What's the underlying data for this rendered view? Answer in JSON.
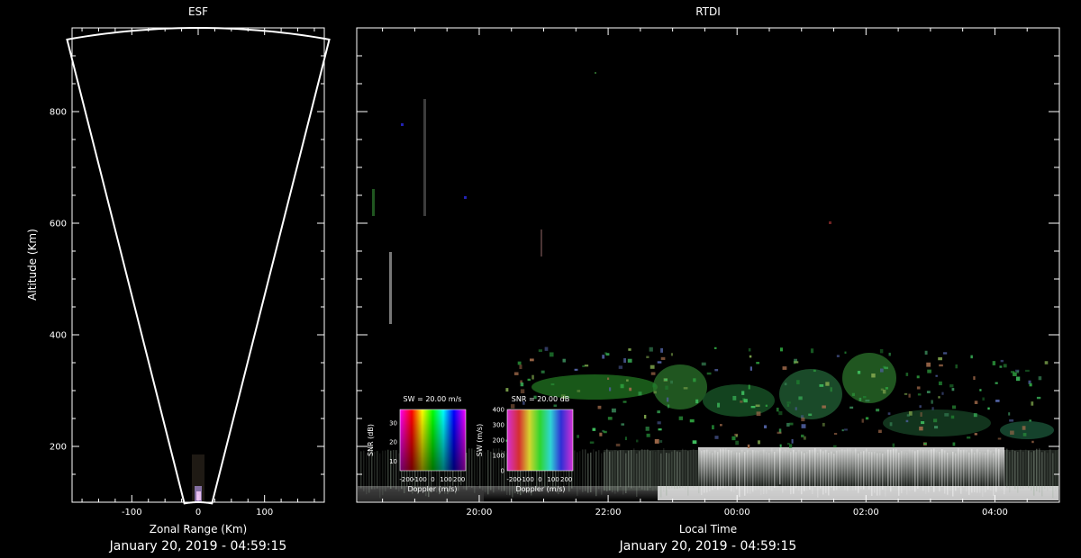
{
  "esf": {
    "title": "ESF",
    "xlabel": "Zonal Range (Km)",
    "ylabel": "Altitude (Km)",
    "date": "January 20, 2019 - 04:59:15"
  },
  "rtdi": {
    "title": "RTDI",
    "xlabel": "Local Time",
    "date": "January 20, 2019 - 04:59:15"
  },
  "legend_sw": {
    "title": "SW = 20.00 m/s",
    "ylabel": "SNR (dB)",
    "xlabel": "Doppler (m/s)"
  },
  "legend_snr": {
    "title": "SNR = 20.00 dB",
    "ylabel": "SW (m/s)",
    "xlabel": "Doppler (m/s)"
  },
  "chart_data": [
    {
      "type": "scatter",
      "title": "ESF",
      "xlabel": "Zonal Range (Km)",
      "ylabel": "Altitude (Km)",
      "xlim": [
        -190,
        190
      ],
      "ylim": [
        100,
        950
      ],
      "x_ticks": [
        -100,
        0,
        100
      ],
      "y_ticks": [
        200,
        400,
        600,
        800
      ],
      "beam_half_angle_deg": 12
    },
    {
      "type": "heatmap",
      "title": "RTDI",
      "xlabel": "Local Time",
      "ylabel": "",
      "xlim_hours": [
        18.1,
        29.0
      ],
      "ylim": [
        100,
        950
      ],
      "x_ticks": [
        "20:00",
        "22:00",
        "00:00",
        "02:00",
        "04:00"
      ],
      "x_tick_hours": [
        20,
        22,
        24,
        26,
        28
      ],
      "y_ticks": [
        200,
        400,
        600,
        800
      ]
    },
    {
      "type": "heatmap",
      "title": "SW = 20.00 m/s",
      "xlabel": "Doppler (m/s)",
      "ylabel": "SNR (dB)",
      "xlim": [
        -250,
        250
      ],
      "ylim": [
        5,
        37
      ],
      "x_ticks": [
        "-200",
        "-100",
        "0",
        "100",
        "200"
      ],
      "y_ticks": [
        10,
        20,
        30
      ]
    },
    {
      "type": "heatmap",
      "title": "SNR = 20.00 dB",
      "xlabel": "Doppler (m/s)",
      "ylabel": "SW (m/s)",
      "xlim": [
        -250,
        250
      ],
      "ylim": [
        0,
        400
      ],
      "x_ticks": [
        "-200",
        "-100",
        "0",
        "100",
        "200"
      ],
      "y_ticks": [
        0,
        100,
        200,
        300,
        400
      ]
    }
  ]
}
